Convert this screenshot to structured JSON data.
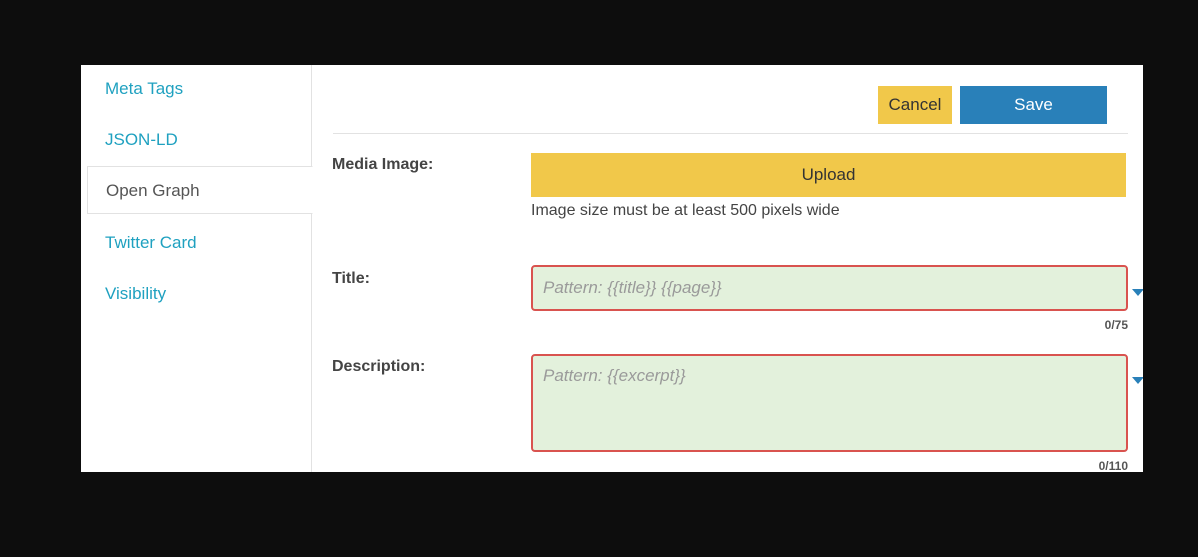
{
  "sidebar": {
    "items": [
      {
        "label": "Meta Tags"
      },
      {
        "label": "JSON-LD"
      },
      {
        "label": "Open Graph"
      },
      {
        "label": "Twitter Card"
      },
      {
        "label": "Visibility"
      }
    ],
    "active": "Open Graph"
  },
  "toolbar": {
    "cancel_label": "Cancel",
    "save_label": "Save"
  },
  "form": {
    "media_image": {
      "label": "Media Image:",
      "upload_label": "Upload",
      "hint": "Image size must be at least 500 pixels wide"
    },
    "title": {
      "label": "Title:",
      "value": "",
      "placeholder": "Pattern: {{title}} {{page}}",
      "counter": "0/75"
    },
    "description": {
      "label": "Description:",
      "value": "",
      "placeholder": "Pattern: {{excerpt}}",
      "counter": "0/110"
    }
  },
  "colors": {
    "link": "#1fa1c0",
    "cancel_bg": "#f1c84a",
    "save_bg": "#2980b9",
    "field_bg": "#e3f1dc",
    "field_error_border": "#d9534f"
  },
  "icons": [
    "chevron-down-icon"
  ]
}
